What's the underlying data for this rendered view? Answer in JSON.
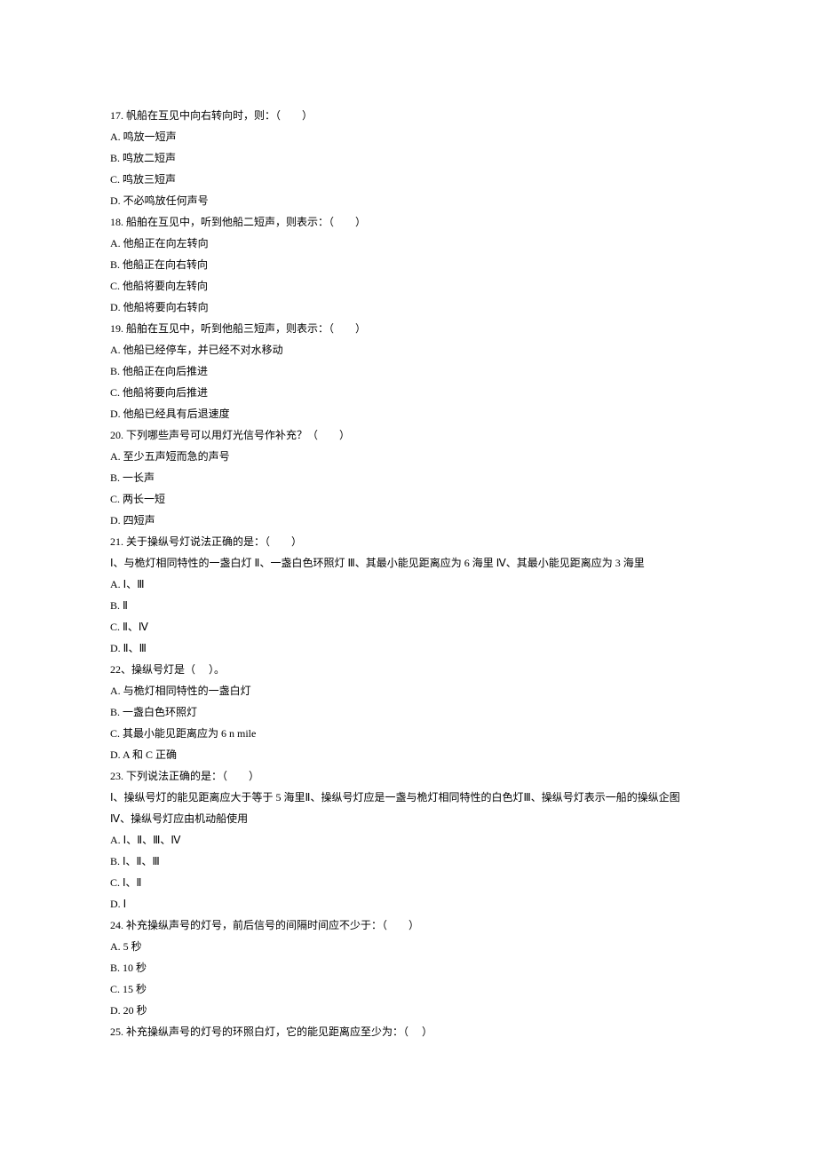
{
  "questions": [
    {
      "stem": "17. 帆船在互见中向右转向时，则：（　　）",
      "options": [
        "A. 鸣放一短声",
        "B. 鸣放二短声",
        "C. 鸣放三短声",
        "D. 不必鸣放任何声号"
      ]
    },
    {
      "stem": "18. 船舶在互见中，听到他船二短声，则表示：（　　）",
      "options": [
        "A. 他船正在向左转向",
        "B. 他船正在向右转向",
        "C. 他船将要向左转向",
        "D. 他船将要向右转向"
      ]
    },
    {
      "stem": "19. 船舶在互见中，听到他船三短声，则表示：（　　）",
      "options": [
        "A. 他船已经停车，并已经不对水移动",
        "B. 他船正在向后推进",
        "C. 他船将要向后推进",
        "D. 他船已经具有后退速度"
      ]
    },
    {
      "stem": "20. 下列哪些声号可以用灯光信号作补充？（　　）",
      "options": [
        "A. 至少五声短而急的声号",
        "B. 一长声",
        "C. 两长一短",
        "D. 四短声"
      ]
    },
    {
      "stem": "21. 关于操纵号灯说法正确的是：（　　）",
      "sub": "Ⅰ、与桅灯相同特性的一盏白灯 Ⅱ、一盏白色环照灯 Ⅲ、其最小能见距离应为 6 海里 Ⅳ、其最小能见距离应为 3 海里",
      "options": [
        "A. Ⅰ、Ⅲ",
        "B. Ⅱ",
        "C. Ⅱ、Ⅳ",
        "D. Ⅱ、Ⅲ"
      ]
    },
    {
      "stem": "22、操纵号灯是（　 ）。",
      "options": [
        "A. 与桅灯相同特性的一盏白灯",
        "B. 一盏白色环照灯",
        "C. 其最小能见距离应为 6 n mile",
        "D. A 和 C 正确"
      ]
    },
    {
      "stem": "23. 下列说法正确的是：（　　）",
      "sub": "Ⅰ、操纵号灯的能见距离应大于等于 5 海里Ⅱ、操纵号灯应是一盏与桅灯相同特性的白色灯Ⅲ、操纵号灯表示一船的操纵企图",
      "sub2": "Ⅳ、操纵号灯应由机动船使用",
      "options": [
        "A. Ⅰ、Ⅱ、Ⅲ、Ⅳ",
        "B. Ⅰ、Ⅱ、Ⅲ",
        "C. Ⅰ、Ⅱ",
        "D. Ⅰ"
      ]
    },
    {
      "stem": "24. 补充操纵声号的灯号，前后信号的间隔时间应不少于：（　　）",
      "options": [
        "A. 5 秒",
        "B. 10 秒",
        "C. 15 秒",
        "D. 20 秒"
      ]
    },
    {
      "stem": "25. 补充操纵声号的灯号的环照白灯，它的能见距离应至少为：（　 ）",
      "options": []
    }
  ]
}
